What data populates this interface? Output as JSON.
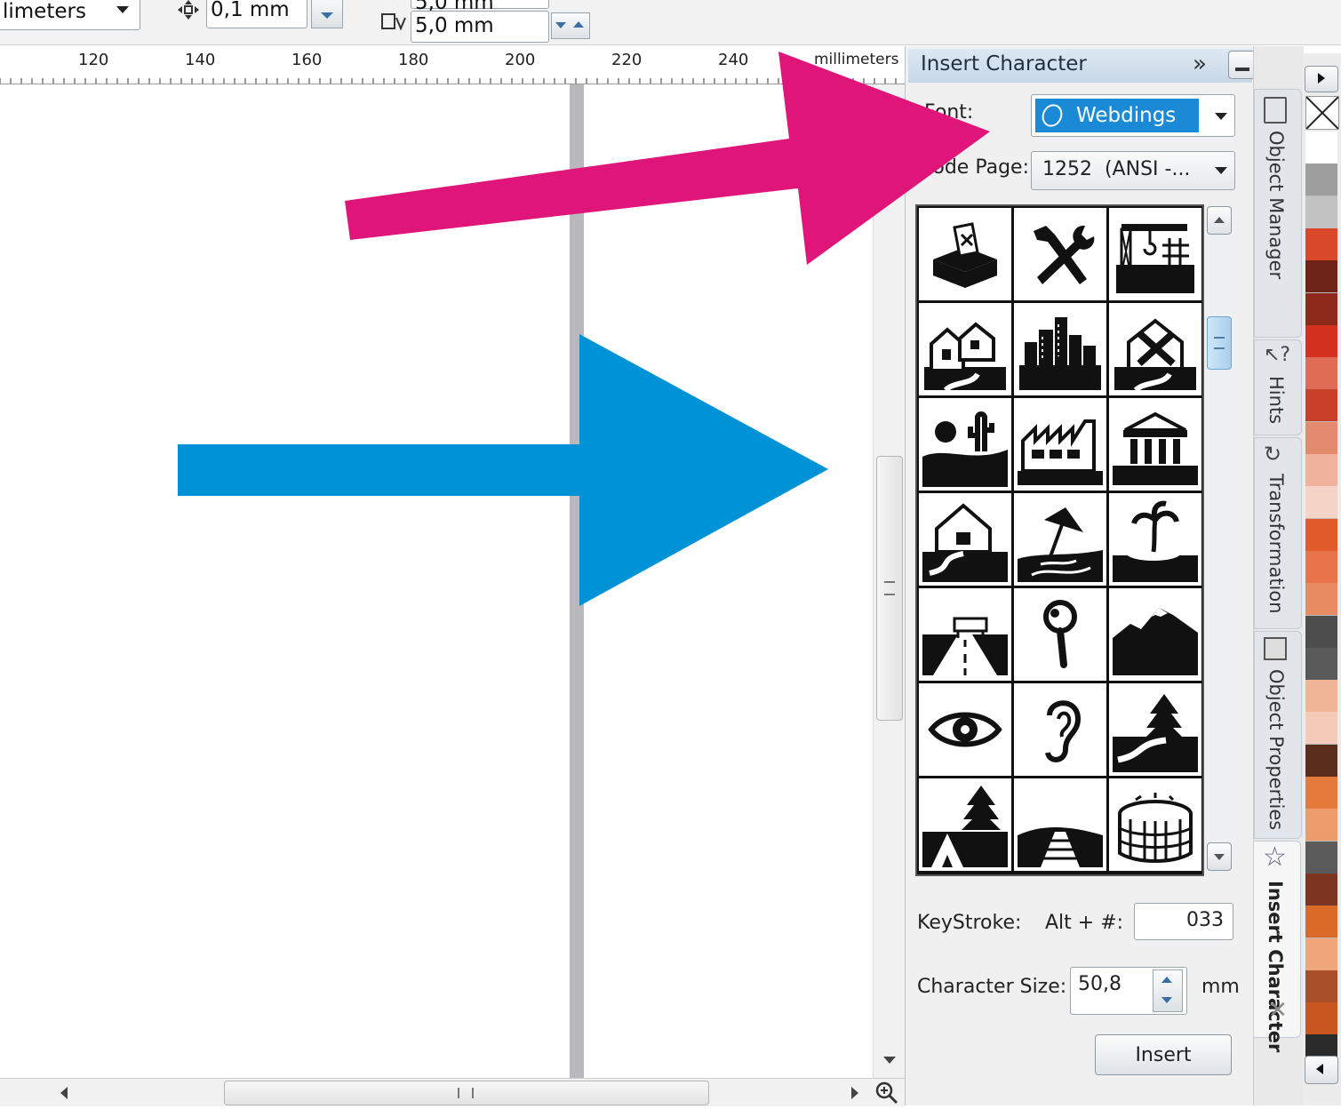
{
  "toolbar": {
    "units_value": "limeters",
    "nudge_value": "0,1 mm",
    "dup_x_value": "5,0 mm",
    "dup_y_value": "5,0 mm"
  },
  "ruler": {
    "labels": [
      "120",
      "140",
      "160",
      "180",
      "200",
      "220",
      "240"
    ],
    "unit": "millimeters"
  },
  "docker": {
    "title": "Insert Character",
    "font_label": "Font:",
    "font_value": "Webdings",
    "code_page_label": "Code Page:",
    "code_page_value": "1252  (ANSI -...",
    "glyphs": [
      "ballot-box-icon",
      "tools-icon",
      "construction-crane-icon",
      "houses-icon",
      "city-icon",
      "house-deleted-icon",
      "desert-icon",
      "factory-icon",
      "government-building-icon",
      "house-road-icon",
      "beach-umbrella-icon",
      "island-icon",
      "highway-icon",
      "magnifier-icon",
      "mountain-icon",
      "eye-icon",
      "ear-icon",
      "forest-road-icon",
      "camping-icon",
      "railway-icon",
      "stadium-icon"
    ],
    "keystroke_label": "KeyStroke:",
    "alt_label": "Alt + #:",
    "keystroke_value": "033",
    "char_size_label": "Character Size:",
    "char_size_value": "50,8",
    "char_size_unit": "mm",
    "insert_label": "Insert"
  },
  "side_tabs": [
    "Object Manager",
    "Hints",
    "Transformation",
    "Object Properties",
    "Insert Character"
  ],
  "palette": [
    "#ffffff",
    "#9e9e9e",
    "#c2c2c2",
    "#d9482b",
    "#6e2318",
    "#8e2a1c",
    "#d3301f",
    "#e06c55",
    "#c8402a",
    "#e48a6e",
    "#f0b29c",
    "#f5d3c6",
    "#e05a2a",
    "#e9744a",
    "#e88d63",
    "#4d4d4d",
    "#595959",
    "#efb596",
    "#f4cbb8",
    "#5a2d1c",
    "#e57a3d",
    "#ee9c6b",
    "#5b5b5b",
    "#7b3521",
    "#d96a28",
    "#efa77a",
    "#a9502a",
    "#c8561e",
    "#2b2b2b"
  ],
  "annotations": {
    "pink_arrow_color": "#e0157a",
    "blue_arrow_color": "#0092d6"
  }
}
